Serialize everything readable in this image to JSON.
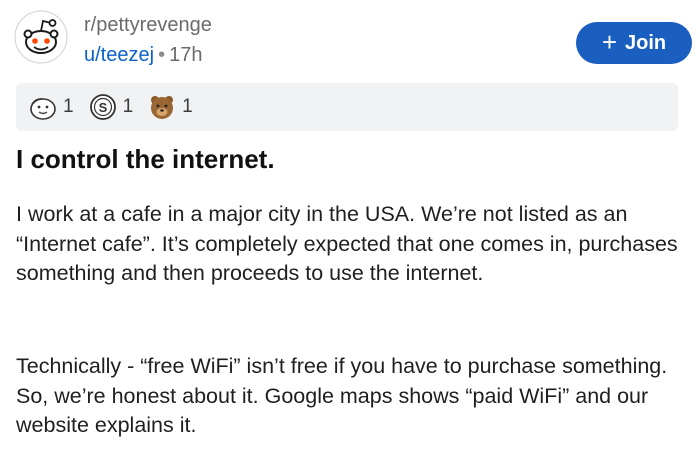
{
  "post": {
    "subreddit": "r/pettyrevenge",
    "author": "u/teezej",
    "separator": "•",
    "age": "17h",
    "join_label": "Join",
    "join_icon": "+",
    "awards": [
      {
        "name": "wholesome-seal-award",
        "count": "1"
      },
      {
        "name": "silver-award",
        "count": "1"
      },
      {
        "name": "bear-award",
        "count": "1"
      }
    ],
    "title": "I control the internet.",
    "paragraphs": [
      "I work at a cafe in a major city in the USA. We’re not listed as an “Internet cafe”. It’s completely expected that one comes in, purchases something and then proceeds to use the internet.",
      "Technically - “free WiFi” isn’t free if you have to purchase something. So, we’re honest about it. Google maps shows “paid WiFi” and our website explains it."
    ]
  },
  "colors": {
    "join_button": "#1a5fc0",
    "username": "#0a62c9",
    "award_bar": "#f1f2f4"
  }
}
